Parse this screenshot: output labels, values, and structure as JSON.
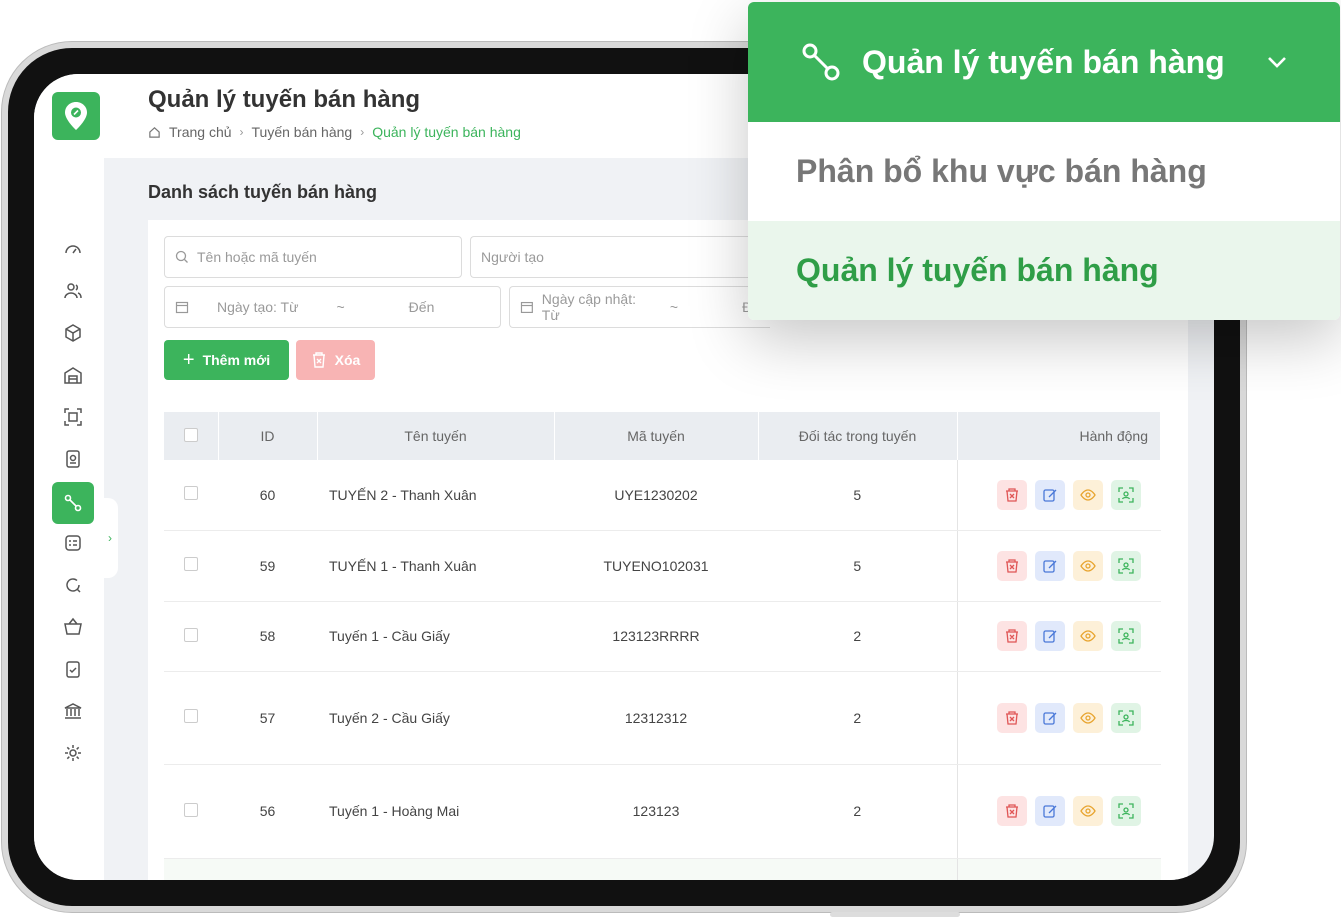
{
  "header": {
    "title": "Quản lý tuyến bán hàng",
    "breadcrumb": [
      "Trang chủ",
      "Tuyến bán hàng",
      "Quản lý tuyến bán hàng"
    ]
  },
  "section": {
    "title": "Danh sách tuyến bán hàng"
  },
  "filters": {
    "search_placeholder": "Tên hoặc mã tuyến",
    "creator_placeholder": "Người tạo",
    "created_from": "Ngày tạo: Từ",
    "created_tilde": "~",
    "created_to": "Đến",
    "updated_from": "Ngày cập nhật: Từ",
    "updated_tilde": "~",
    "updated_to": "Đế"
  },
  "toolbar": {
    "add_label": "Thêm mới",
    "delete_label": "Xóa"
  },
  "table": {
    "columns": [
      "ID",
      "Tên tuyến",
      "Mã tuyến",
      "Đối tác trong tuyến",
      "Hành động"
    ],
    "rows": [
      {
        "id": "60",
        "name": "TUYẾN 2 - Thanh Xuân",
        "code": "UYE1230202",
        "partners": "5"
      },
      {
        "id": "59",
        "name": "TUYẾN 1 - Thanh Xuân",
        "code": "TUYENO102031",
        "partners": "5"
      },
      {
        "id": "58",
        "name": "Tuyến 1 - Cầu Giấy",
        "code": "123123RRRR",
        "partners": "2"
      },
      {
        "id": "57",
        "name": "Tuyến 2 - Cầu Giấy",
        "code": "12312312",
        "partners": "2"
      },
      {
        "id": "56",
        "name": "Tuyến 1 - Hoàng Mai",
        "code": "123123",
        "partners": "2"
      }
    ]
  },
  "sidebar": {
    "icons": [
      "dashboard-icon",
      "users-icon",
      "box-icon",
      "warehouse-icon",
      "scan-icon",
      "badge-icon",
      "route-icon",
      "checklist-icon",
      "refresh-search-icon",
      "basket-icon",
      "clipboard-check-icon",
      "bank-icon",
      "settings-icon"
    ],
    "active": "route-icon"
  },
  "popup": {
    "heading": "Quản lý tuyến bán hàng",
    "items": [
      "Phân bổ khu vực bán hàng",
      "Quản lý tuyến bán hàng"
    ],
    "selected": "Quản lý tuyến bán hàng"
  },
  "colors": {
    "brand": "#3cb45c",
    "brand_dark": "#2f9e47",
    "danger_light": "#f8b4b4"
  }
}
